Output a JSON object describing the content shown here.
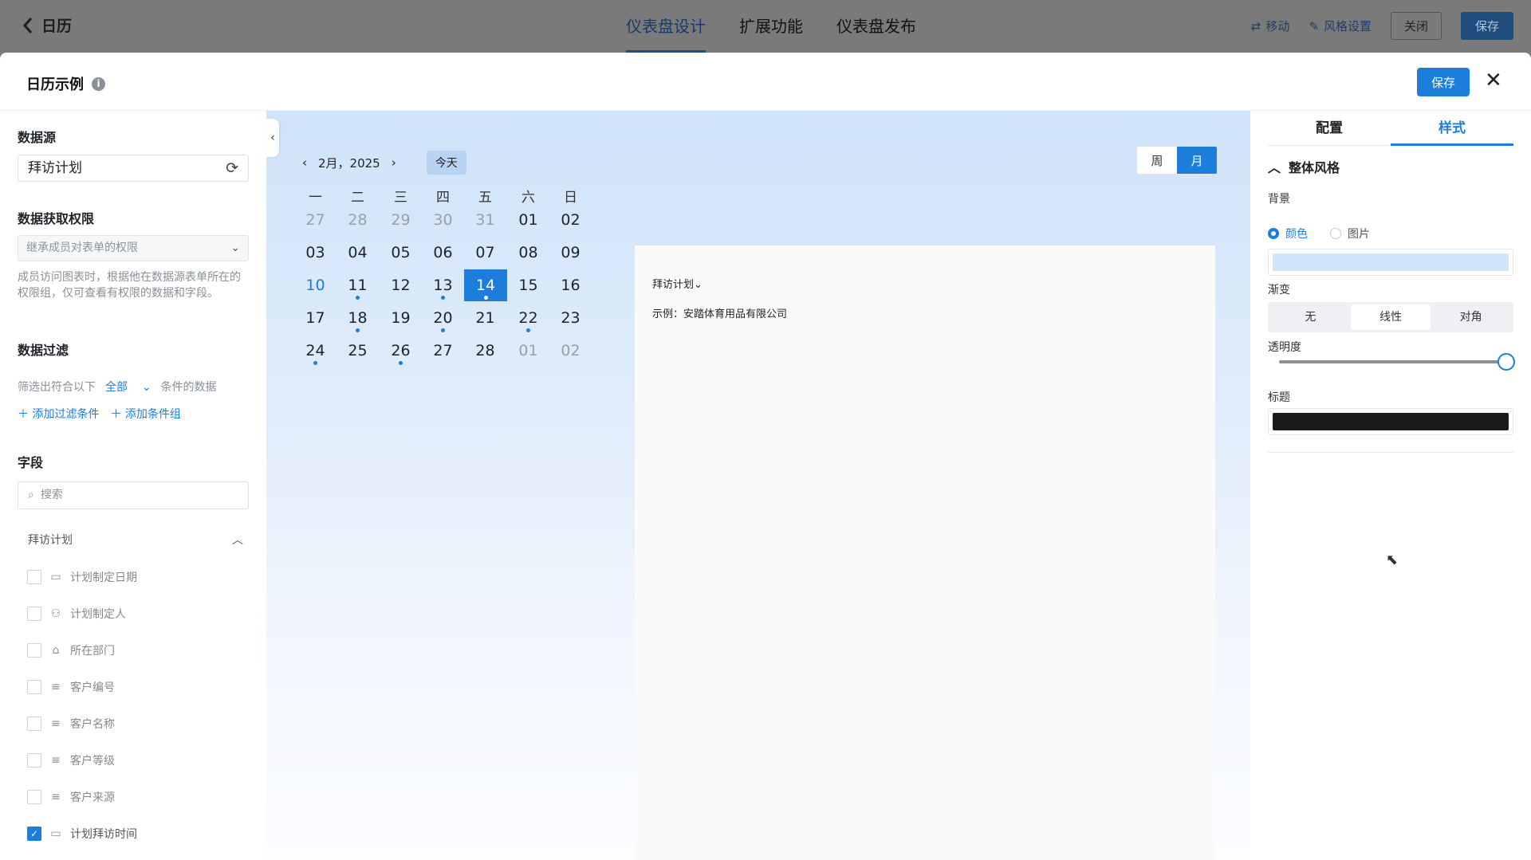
{
  "topbar": {
    "back_title": "日历",
    "tabs": [
      "仪表盘设计",
      "扩展功能",
      "仪表盘发布"
    ],
    "move": "移动",
    "style_settings": "风格设置",
    "close": "关闭",
    "save": "保存"
  },
  "modal": {
    "title": "日历示例",
    "save": "保存"
  },
  "left": {
    "datasource_title": "数据源",
    "datasource_value": "拜访计划",
    "perm_title": "数据获取权限",
    "perm_value": "继承成员对表单的权限",
    "perm_desc": "成员访问图表时，根据他在数据源表单所在的权限组，仅可查看有权限的数据和字段。",
    "filter_title": "数据过滤",
    "filter_prefix": "筛选出符合以下",
    "filter_all": "全部",
    "filter_suffix": "条件的数据",
    "add_filter": "添加过滤条件",
    "add_group": "添加条件组",
    "fields_title": "字段",
    "search_placeholder": "搜索",
    "group_name": "拜访计划",
    "fields": [
      {
        "label": "计划制定日期",
        "icon": "calendar-icon",
        "checked": false
      },
      {
        "label": "计划制定人",
        "icon": "user-icon",
        "checked": false
      },
      {
        "label": "所在部门",
        "icon": "department-icon",
        "checked": false
      },
      {
        "label": "客户编号",
        "icon": "text-lines-icon",
        "checked": false
      },
      {
        "label": "客户名称",
        "icon": "text-lines-icon",
        "checked": false
      },
      {
        "label": "客户等级",
        "icon": "text-lines-icon",
        "checked": false
      },
      {
        "label": "客户来源",
        "icon": "text-lines-icon",
        "checked": false
      },
      {
        "label": "计划拜访时间",
        "icon": "calendar-icon",
        "checked": true
      }
    ]
  },
  "calendar": {
    "month_label": "2月，2025",
    "today": "今天",
    "view_week": "周",
    "view_month": "月",
    "weekdays": [
      "一",
      "二",
      "三",
      "四",
      "五",
      "六",
      "日"
    ],
    "weeks": [
      [
        "27",
        "28",
        "29",
        "30",
        "31",
        "01",
        "02"
      ],
      [
        "03",
        "04",
        "05",
        "06",
        "07",
        "08",
        "09"
      ],
      [
        "10",
        "11",
        "12",
        "13",
        "14",
        "15",
        "16"
      ],
      [
        "17",
        "18",
        "19",
        "20",
        "21",
        "22",
        "23"
      ],
      [
        "24",
        "25",
        "26",
        "27",
        "28",
        "01",
        "02"
      ]
    ],
    "selected_day": "14",
    "event_source": "拜访计划",
    "event_example": "示例：安踏体育用品有限公司"
  },
  "right": {
    "tab_config": "配置",
    "tab_style": "样式",
    "section": "整体风格",
    "bg_label": "背景",
    "bg_color": "颜色",
    "bg_image": "图片",
    "bg_swatch": "#cfe3f9",
    "gradient_label": "渐变",
    "gradient_options": [
      "无",
      "线性",
      "对角"
    ],
    "gradient_selected": "线性",
    "opacity_label": "透明度",
    "opacity": 1.0,
    "title_label": "标题",
    "title_swatch": "#1a1a1a"
  },
  "colors": {
    "accent": "#1d7ddb"
  }
}
